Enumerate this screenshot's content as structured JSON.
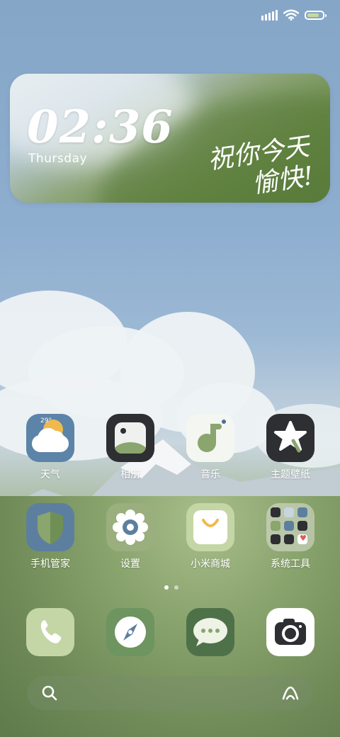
{
  "status_bar": {
    "signal_icon": "signal-icon",
    "wifi_icon": "wifi-icon",
    "battery_icon": "battery-icon",
    "battery_level": 0.85,
    "battery_color": "#c8d89e"
  },
  "clock_widget": {
    "time": "02:36",
    "weekday": "Thursday",
    "greeting_line1": "祝你今天",
    "greeting_line2": "愉快!"
  },
  "apps": [
    {
      "label": "天气",
      "icon": "weather-icon",
      "temp": "29°"
    },
    {
      "label": "相册",
      "icon": "gallery-icon"
    },
    {
      "label": "音乐",
      "icon": "music-icon"
    },
    {
      "label": "主题壁纸",
      "icon": "themes-icon"
    },
    {
      "label": "手机管家",
      "icon": "security-icon"
    },
    {
      "label": "设置",
      "icon": "settings-icon"
    },
    {
      "label": "小米商城",
      "icon": "mi-store-icon"
    },
    {
      "label": "系统工具",
      "icon": "system-tools-folder-icon"
    }
  ],
  "page_indicator": {
    "pages": 2,
    "current": 1
  },
  "dock": [
    {
      "icon": "phone-icon"
    },
    {
      "icon": "browser-compass-icon"
    },
    {
      "icon": "messages-icon"
    },
    {
      "icon": "camera-icon"
    }
  ],
  "search_bar": {
    "search_icon": "search-icon",
    "assistant_icon": "assistant-icon"
  },
  "colors": {
    "sky": "#8eaed0",
    "meadow": "#7d9663",
    "accent_green": "#8aa56d",
    "sage": "#c4d6a6"
  }
}
